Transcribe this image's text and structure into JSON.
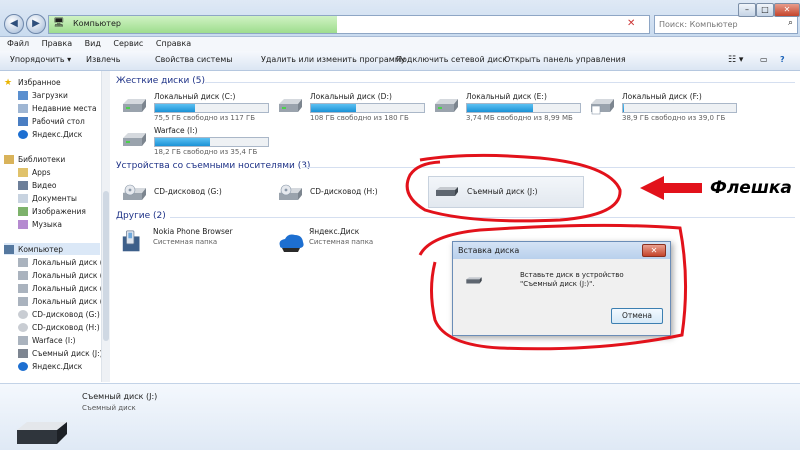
{
  "window": {
    "address": "Компьютер",
    "search_placeholder": "Поиск: Компьютер",
    "btn_min": "–",
    "btn_max": "□",
    "btn_close": "✕"
  },
  "menu": [
    "Файл",
    "Правка",
    "Вид",
    "Сервис",
    "Справка"
  ],
  "toolbar": {
    "organize": "Упорядочить ▾",
    "eject": "Извлечь",
    "system_props": "Свойства системы",
    "uninstall": "Удалить или изменить программу",
    "map_drive": "Подключить сетевой диск",
    "control_panel": "Открыть панель управления"
  },
  "nav": {
    "favorites": "Избранное",
    "fav_items": [
      "Загрузки",
      "Недавние места",
      "Рабочий стол",
      "Яндекс.Диск"
    ],
    "libraries": "Библиотеки",
    "lib_items": [
      "Apps",
      "Видео",
      "Документы",
      "Изображения",
      "Музыка"
    ],
    "computer": "Компьютер",
    "comp_items": [
      "Локальный диск (C",
      "Локальный диск (D",
      "Локальный диск (E",
      "Локальный диск (F",
      "CD-дисковод (G:)",
      "CD-дисковод (H:)",
      "Warface (I:)",
      "Съемный диск (J:)",
      "Яндекс.Диск"
    ]
  },
  "groups": {
    "hdd": "Жесткие диски (5)",
    "removable": "Устройства со съемными носителями (3)",
    "other": "Другие (2)"
  },
  "drives": [
    {
      "name": "Локальный диск (C:)",
      "free": "75,5 ГБ свободно из 117 ГБ",
      "used": 0.35
    },
    {
      "name": "Локальный диск (D:)",
      "free": "108 ГБ свободно из 180 ГБ",
      "used": 0.4
    },
    {
      "name": "Локальный диск (E:)",
      "free": "3,74 МБ свободно из 8,99 МБ",
      "used": 0.58
    },
    {
      "name": "Локальный диск (F:)",
      "free": "38,9 ГБ свободно из 39,0 ГБ",
      "used": 0.01
    },
    {
      "name": "Warface (I:)",
      "free": "18,2 ГБ свободно из 35,4 ГБ",
      "used": 0.49
    }
  ],
  "removable": [
    "CD-дисковод (G:)",
    "CD-дисковод (H:)",
    "Съемный диск (J:)"
  ],
  "other": [
    {
      "name": "Nokia Phone Browser",
      "type": "Системная папка"
    },
    {
      "name": "Яндекс.Диск",
      "type": "Системная папка"
    }
  ],
  "dialog": {
    "title": "Вставка диска",
    "message": "Вставьте диск в устройство \"Съемный диск (J:)\".",
    "cancel": "Отмена",
    "close": "✕"
  },
  "details": {
    "name": "Съемный диск (J:)",
    "type": "Съемный диск"
  },
  "annotation": "Флешка",
  "colors": {
    "annotation_red": "#e2121b",
    "accent": "#1e3287"
  }
}
